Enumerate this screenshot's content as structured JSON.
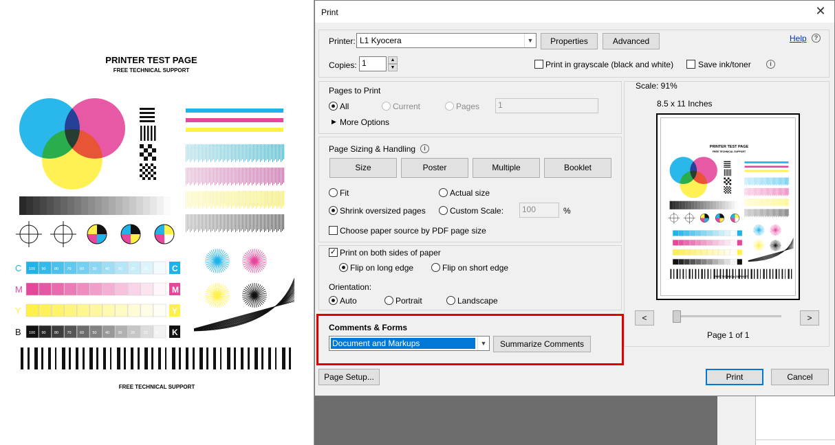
{
  "document": {
    "title": "PRINTER TEST PAGE",
    "subtitle": "FREE TECHNICAL SUPPORT",
    "footer": "FREE TECHNICAL SUPPORT",
    "cmyk_labels": [
      "C",
      "M",
      "Y",
      "B"
    ],
    "cmyk_end_labels": [
      "C",
      "M",
      "Y",
      "K"
    ],
    "scale_values": [
      "100",
      "90",
      "80",
      "70",
      "60",
      "50",
      "40",
      "30",
      "20",
      "10",
      "0"
    ],
    "colors": {
      "cyan": "#1fb3e8",
      "magenta": "#e5479b",
      "yellow": "#fff04a",
      "black": "#111111"
    }
  },
  "dialog": {
    "title": "Print",
    "close_glyph": "✕",
    "printer_label": "Printer:",
    "printer_value": "L1 Kyocera",
    "properties_button": "Properties",
    "advanced_button": "Advanced",
    "help_link": "Help",
    "help_icon": "?",
    "copies_label": "Copies:",
    "copies_value": "1",
    "grayscale_label": "Print in grayscale (black and white)",
    "save_ink_label": "Save ink/toner",
    "info_glyph": "i",
    "pages_to_print": {
      "title": "Pages to Print",
      "all": "All",
      "current": "Current",
      "pages": "Pages",
      "pages_value": "1",
      "more_options": "More Options"
    },
    "sizing": {
      "title": "Page Sizing & Handling",
      "size_button": "Size",
      "poster_button": "Poster",
      "multiple_button": "Multiple",
      "booklet_button": "Booklet",
      "fit": "Fit",
      "actual_size": "Actual size",
      "shrink": "Shrink oversized pages",
      "custom_scale": "Custom Scale:",
      "custom_scale_value": "100",
      "percent": "%",
      "paper_source": "Choose paper source by PDF page size"
    },
    "duplex": {
      "both_sides": "Print on both sides of paper",
      "flip_long": "Flip on long edge",
      "flip_short": "Flip on short edge"
    },
    "orientation": {
      "title": "Orientation:",
      "auto": "Auto",
      "portrait": "Portrait",
      "landscape": "Landscape"
    },
    "comments": {
      "title": "Comments & Forms",
      "value": "Document and Markups",
      "summarize_button": "Summarize Comments"
    },
    "preview": {
      "scale": "Scale:  91%",
      "paper_size": "8.5 x 11 Inches",
      "prev_glyph": "<",
      "next_glyph": ">",
      "page_indicator": "Page 1 of 1",
      "slider_position": 0
    },
    "page_setup_button": "Page Setup...",
    "print_button": "Print",
    "cancel_button": "Cancel"
  }
}
